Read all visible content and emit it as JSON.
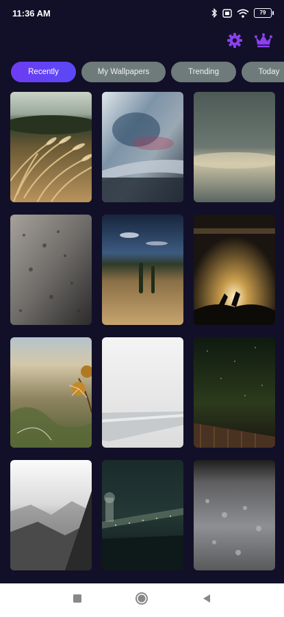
{
  "status": {
    "time": "11:36 AM",
    "battery": "79"
  },
  "icons": {
    "settings": "gear-icon",
    "premium": "crown-icon",
    "bluetooth": "bluetooth-icon",
    "wifi": "wifi-icon"
  },
  "colors": {
    "accent": "#7b3ff2",
    "background": "#121028",
    "tab_inactive": "#6f7b7b"
  },
  "tabs": [
    {
      "label": "Recently",
      "active": true
    },
    {
      "label": "My Wallpapers",
      "active": false
    },
    {
      "label": "Trending",
      "active": false
    },
    {
      "label": "Today",
      "active": false
    }
  ],
  "wallpapers": [
    {
      "subject": "wheat field"
    },
    {
      "subject": "blurred water abstract"
    },
    {
      "subject": "cloudy horizon"
    },
    {
      "subject": "rocky surface"
    },
    {
      "subject": "tuscany field with cypress trees"
    },
    {
      "subject": "concert crowd under lights"
    },
    {
      "subject": "valley with dried flower"
    },
    {
      "subject": "white laptop"
    },
    {
      "subject": "night sky over fence"
    },
    {
      "subject": "misty mountains"
    },
    {
      "subject": "city bridge at night"
    },
    {
      "subject": "grey rock texture"
    }
  ]
}
